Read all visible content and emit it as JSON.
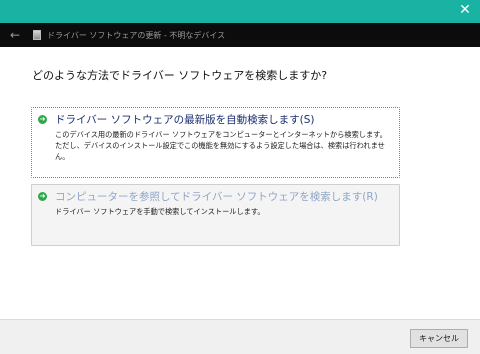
{
  "window": {
    "close_glyph": "✕",
    "title_bar_color": "#1ab2a3"
  },
  "nav": {
    "back_glyph": "←",
    "title": "ドライバー ソフトウェアの更新 - 不明なデバイス"
  },
  "main": {
    "question": "どのような方法でドライバー ソフトウェアを検索しますか?",
    "options": [
      {
        "title": "ドライバー ソフトウェアの最新版を自動検索します(S)",
        "description": "このデバイス用の最新のドライバー ソフトウェアをコンピューターとインターネットから検索します。ただし、デバイスのインストール設定でこの機能を無効にするよう設定した場合は、検索は行われません。",
        "icon": "green-arrow-icon"
      },
      {
        "title": "コンピューターを参照してドライバー ソフトウェアを検索します(R)",
        "description": "ドライバー ソフトウェアを手動で検索してインストールします。",
        "icon": "green-arrow-icon"
      }
    ]
  },
  "footer": {
    "cancel_label": "キャンセル"
  }
}
